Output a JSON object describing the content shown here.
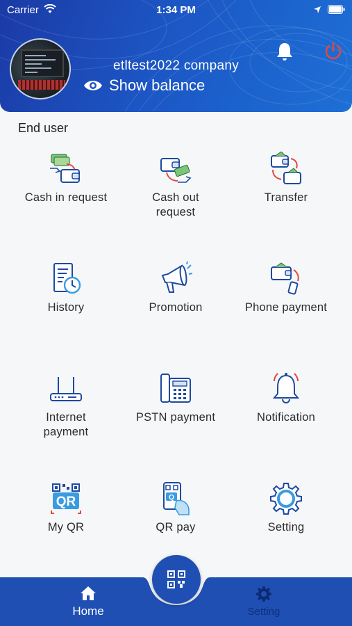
{
  "status_bar": {
    "carrier": "Carrier",
    "time": "1:34 PM"
  },
  "header": {
    "company": "etltest2022 company",
    "show_balance": "Show balance"
  },
  "section_title": "End user",
  "tiles": [
    {
      "label": "Cash in request",
      "icon": "cash-in-icon"
    },
    {
      "label": "Cash out request",
      "icon": "cash-out-icon"
    },
    {
      "label": "Transfer",
      "icon": "transfer-icon"
    },
    {
      "label": "History",
      "icon": "history-icon"
    },
    {
      "label": "Promotion",
      "icon": "megaphone-icon"
    },
    {
      "label": "Phone payment",
      "icon": "phone-payment-icon"
    },
    {
      "label": "Internet payment",
      "icon": "router-icon"
    },
    {
      "label": "PSTN payment",
      "icon": "desk-phone-icon"
    },
    {
      "label": "Notification",
      "icon": "bell-icon"
    },
    {
      "label": "My QR",
      "icon": "qr-icon"
    },
    {
      "label": "QR pay",
      "icon": "qr-pay-icon"
    },
    {
      "label": "Setting",
      "icon": "gear-icon"
    }
  ],
  "bottom_nav": {
    "home": "Home",
    "setting": "Setting"
  },
  "colors": {
    "primary": "#1f4fb3",
    "header": "#1c56c4",
    "accent_red": "#e0493f",
    "icon_blue": "#1d4a9f"
  }
}
